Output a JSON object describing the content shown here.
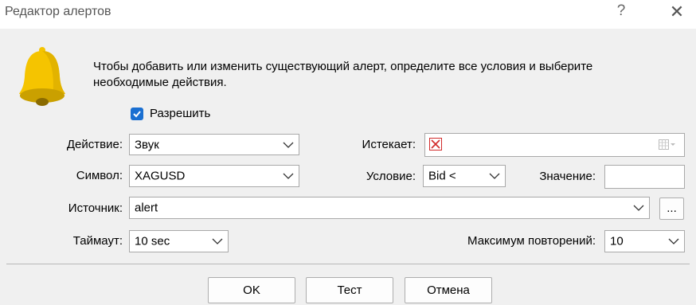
{
  "window": {
    "title": "Редактор алертов",
    "help": "?",
    "close": "✕"
  },
  "description": "Чтобы добавить или изменить существующий алерт, определите все условия и выберите необходимые действия.",
  "enable": {
    "label": "Разрешить",
    "checked": true
  },
  "action": {
    "label": "Действие:",
    "value": "Звук"
  },
  "expires": {
    "label": "Истекает:",
    "checked": false
  },
  "symbol": {
    "label": "Символ:",
    "value": "XAGUSD"
  },
  "condition": {
    "label": "Условие:",
    "value": "Bid <"
  },
  "value_field": {
    "label": "Значение:",
    "value": ""
  },
  "source": {
    "label": "Источник:",
    "value": "alert",
    "browse": "..."
  },
  "timeout": {
    "label": "Таймаут:",
    "value": "10 sec"
  },
  "max_repeats": {
    "label": "Максимум повторений:",
    "value": "10"
  },
  "buttons": {
    "ok": "OK",
    "test": "Тест",
    "cancel": "Отмена"
  },
  "colors": {
    "accent": "#1a6fd1",
    "bell": "#f5c400",
    "bell_shade": "#caa000"
  }
}
